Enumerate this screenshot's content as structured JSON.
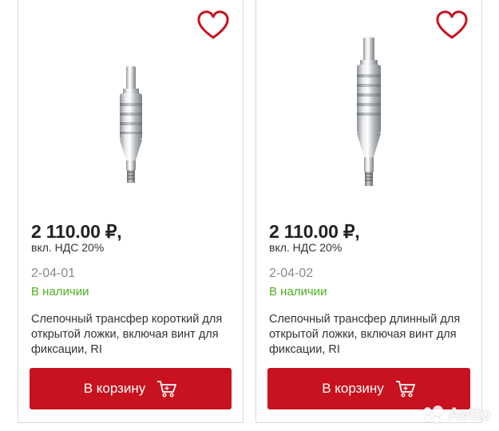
{
  "products": [
    {
      "price": "2 110.00 ₽,",
      "vat": "вкл. НДС 20%",
      "sku": "2-04-01",
      "stock": "В наличии",
      "description": "Слепочный трансфер короткий для открытой ложки, включая винт для фиксации, RI",
      "cart_label": "В корзину"
    },
    {
      "price": "2 110.00 ₽,",
      "vat": "вкл. НДС 20%",
      "sku": "2-04-02",
      "stock": "В наличии",
      "description": "Слепочный трансфер длинный для открытой ложки, включая винт для фиксации, RI",
      "cart_label": "В корзину"
    }
  ],
  "watermark": {
    "text": "Avito"
  },
  "colors": {
    "accent": "#c8121f",
    "stock": "#4caf1e",
    "sku": "#8a8a8a"
  }
}
